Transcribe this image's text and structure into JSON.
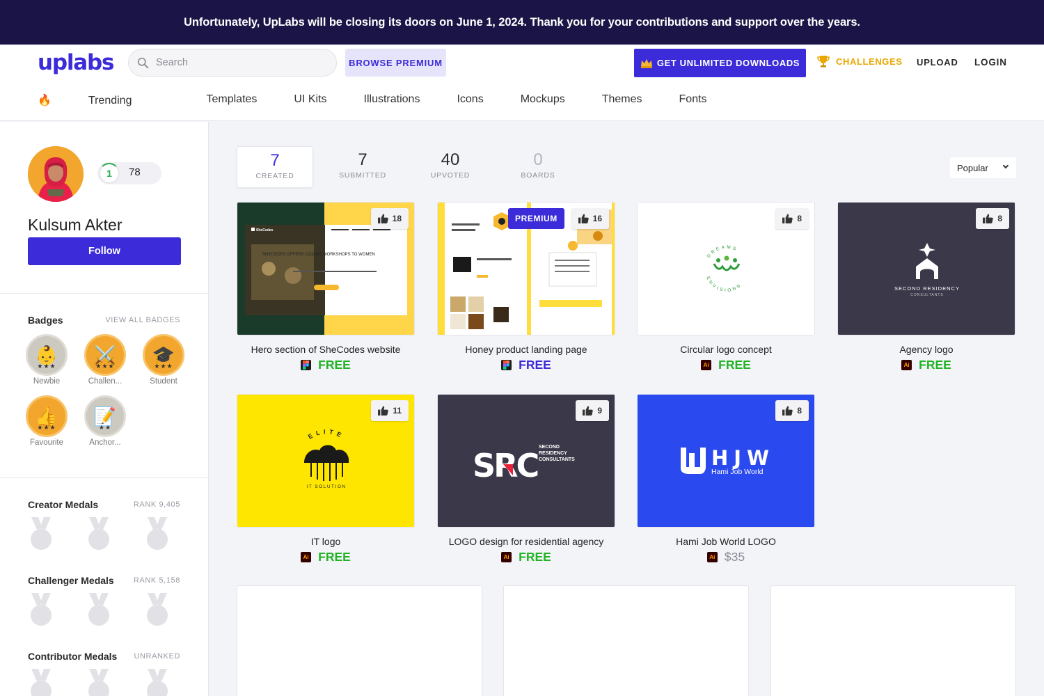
{
  "banner": {
    "text": "Unfortunately, UpLabs will be closing its doors on June 1, 2024. Thank you for your contributions and support over the years."
  },
  "header": {
    "logo_up": "up",
    "logo_labs": "labs",
    "search_placeholder": "Search",
    "browse_premium": "BROWSE PREMIUM",
    "get_unlimited": "GET UNLIMITED DOWNLOADS",
    "challenges": "CHALLENGES",
    "upload": "UPLOAD",
    "login": "LOGIN",
    "brand_color": "#3b2bd9"
  },
  "categories": [
    "Trending",
    "Templates",
    "UI Kits",
    "Illustrations",
    "Icons",
    "Mockups",
    "Themes",
    "Fonts"
  ],
  "profile": {
    "level": "1",
    "points": "78",
    "name": "Kulsum Akter",
    "follow_label": "Follow"
  },
  "badges": {
    "title": "Badges",
    "view_all": "VIEW ALL BADGES",
    "items": [
      {
        "label": "Newbie",
        "icon": "baby-icon",
        "stars": "★★★"
      },
      {
        "label": "Challen...",
        "icon": "crossed-swords-icon",
        "stars": "★★★"
      },
      {
        "label": "Student",
        "icon": "graduation-cap-icon",
        "stars": "★★★"
      },
      {
        "label": "Favourite",
        "icon": "thumbs-up-icon",
        "stars": "★★★"
      },
      {
        "label": "Anchor...",
        "icon": "notepad-icon",
        "stars": "★★"
      }
    ]
  },
  "medals": [
    {
      "title": "Creator Medals",
      "rank": "RANK 9,405"
    },
    {
      "title": "Challenger Medals",
      "rank": "RANK 5,158"
    },
    {
      "title": "Contributor Medals",
      "rank": "UNRANKED"
    }
  ],
  "stats": [
    {
      "value": "7",
      "label": "CREATED"
    },
    {
      "value": "7",
      "label": "SUBMITTED"
    },
    {
      "value": "40",
      "label": "UPVOTED"
    },
    {
      "value": "0",
      "label": "BOARDS"
    }
  ],
  "sort": {
    "selected": "Popular"
  },
  "cards": [
    {
      "title": "Hero section of SheCodes website",
      "likes": "18",
      "tool": "figma-icon",
      "price": "FREE",
      "premium": ""
    },
    {
      "title": "Honey product landing page",
      "likes": "16",
      "tool": "figma-icon",
      "price": "FREE",
      "premium": "PREMIUM"
    },
    {
      "title": "Circular logo concept",
      "likes": "8",
      "tool": "illustrator-icon",
      "price": "FREE",
      "premium": ""
    },
    {
      "title": "Agency logo",
      "likes": "8",
      "tool": "illustrator-icon",
      "price": "FREE",
      "premium": ""
    },
    {
      "title": "IT logo",
      "likes": "11",
      "tool": "illustrator-icon",
      "price": "FREE",
      "premium": ""
    },
    {
      "title": "LOGO design for residential agency",
      "likes": "9",
      "tool": "illustrator-icon",
      "price": "FREE",
      "premium": ""
    },
    {
      "title": "Hami Job World LOGO",
      "likes": "8",
      "tool": "illustrator-icon",
      "price": "$35",
      "premium": ""
    }
  ],
  "thumb_text": {
    "shecodes_brand": "SheCodes",
    "shecodes_headline": "SHECODES OFFERS CODING WORKSHOPS TO WOMEN",
    "dreams_top": "DREAMS",
    "dreams_bottom": "ENVISIONS",
    "second_residency": "SECOND RESIDENCY",
    "second_residency_sub": "CONSULTANTS",
    "elite": "ELITE",
    "it_solution": "IT SOLUTION",
    "src_mark": "SRC",
    "src_line1": "SECOND",
    "src_line2": "RESIDENCY",
    "src_line3": "CONSULTANTS",
    "hjw": "HJW",
    "hjw_sub": "Hami Job World"
  }
}
